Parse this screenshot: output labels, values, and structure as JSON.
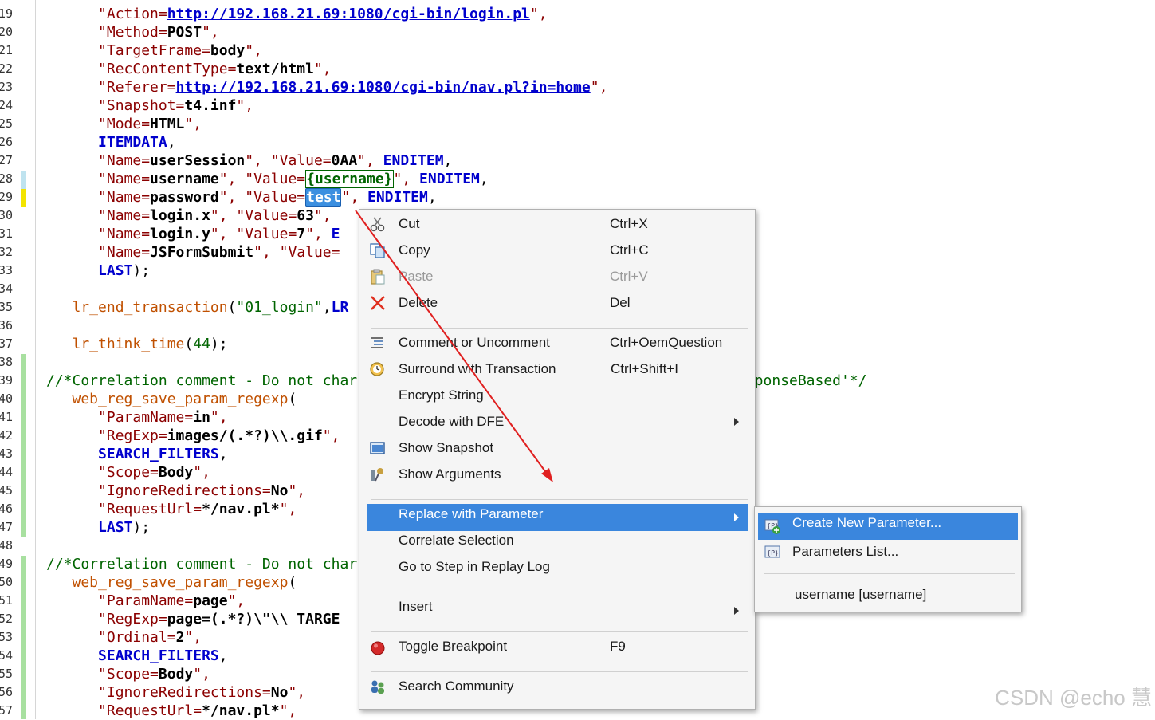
{
  "editor": {
    "line_numbers": [
      "19",
      "20",
      "21",
      "22",
      "23",
      "24",
      "25",
      "26",
      "27",
      "28",
      "29",
      "30",
      "31",
      "32",
      "33",
      "34",
      "35",
      "36",
      "37",
      "38",
      "39",
      "40",
      "41",
      "42",
      "43",
      "44",
      "45",
      "46",
      "47",
      "48",
      "49",
      "50",
      "51",
      "52",
      "53",
      "54",
      "55",
      "56",
      "57"
    ],
    "lines": [
      [
        {
          "c": "s",
          "t": "      \""
        },
        {
          "c": "s",
          "t": "Action="
        },
        {
          "c": "u",
          "t": "http://192.168.21.69:1080/cgi-bin/login.pl"
        },
        {
          "c": "s",
          "t": "\","
        }
      ],
      [
        {
          "c": "s",
          "t": "      \"Method="
        },
        {
          "c": "b",
          "t": "POST"
        },
        {
          "c": "s",
          "t": "\","
        }
      ],
      [
        {
          "c": "s",
          "t": "      \"TargetFrame="
        },
        {
          "c": "b",
          "t": "body"
        },
        {
          "c": "s",
          "t": "\","
        }
      ],
      [
        {
          "c": "s",
          "t": "      \"RecContentType="
        },
        {
          "c": "b",
          "t": "text/html"
        },
        {
          "c": "s",
          "t": "\","
        }
      ],
      [
        {
          "c": "s",
          "t": "      \"Referer="
        },
        {
          "c": "u",
          "t": "http://192.168.21.69:1080/cgi-bin/nav.pl?in=home"
        },
        {
          "c": "s",
          "t": "\","
        }
      ],
      [
        {
          "c": "s",
          "t": "      \"Snapshot="
        },
        {
          "c": "b",
          "t": "t4.inf"
        },
        {
          "c": "s",
          "t": "\","
        }
      ],
      [
        {
          "c": "s",
          "t": "      \"Mode="
        },
        {
          "c": "b",
          "t": "HTML"
        },
        {
          "c": "s",
          "t": "\","
        }
      ],
      [
        {
          "c": "k",
          "t": "      ITEMDATA"
        },
        {
          "c": "",
          "t": ","
        }
      ],
      [
        {
          "c": "s",
          "t": "      \"Name="
        },
        {
          "c": "b",
          "t": "userSession"
        },
        {
          "c": "s",
          "t": "\", \"Value="
        },
        {
          "c": "b",
          "t": "0AA"
        },
        {
          "c": "s",
          "t": "\", "
        },
        {
          "c": "k",
          "t": "ENDITEM"
        },
        {
          "c": "",
          "t": ","
        }
      ],
      [
        {
          "c": "s",
          "t": "      \"Name="
        },
        {
          "c": "b",
          "t": "username"
        },
        {
          "c": "s",
          "t": "\", \"Value="
        },
        {
          "c": "bx",
          "t": "{username}"
        },
        {
          "c": "s",
          "t": "\", "
        },
        {
          "c": "k",
          "t": "ENDITEM"
        },
        {
          "c": "",
          "t": ","
        }
      ],
      [
        {
          "c": "s",
          "t": "      \"Name="
        },
        {
          "c": "b",
          "t": "password"
        },
        {
          "c": "s",
          "t": "\", \"Value="
        },
        {
          "c": "sel",
          "t": "test"
        },
        {
          "c": "s",
          "t": "\", "
        },
        {
          "c": "k",
          "t": "ENDITEM"
        },
        {
          "c": "",
          "t": ","
        }
      ],
      [
        {
          "c": "s",
          "t": "      \"Name="
        },
        {
          "c": "b",
          "t": "login.x"
        },
        {
          "c": "s",
          "t": "\", \"Value="
        },
        {
          "c": "b",
          "t": "63"
        },
        {
          "c": "s",
          "t": "\","
        }
      ],
      [
        {
          "c": "s",
          "t": "      \"Name="
        },
        {
          "c": "b",
          "t": "login.y"
        },
        {
          "c": "s",
          "t": "\", \"Value="
        },
        {
          "c": "b",
          "t": "7"
        },
        {
          "c": "s",
          "t": "\", "
        },
        {
          "c": "k",
          "t": "E"
        }
      ],
      [
        {
          "c": "s",
          "t": "      \"Name="
        },
        {
          "c": "b",
          "t": "JSFormSubmit"
        },
        {
          "c": "s",
          "t": "\", \"Value="
        }
      ],
      [
        {
          "c": "k",
          "t": "      LAST"
        },
        {
          "c": "",
          "t": ");"
        }
      ],
      [
        {
          "c": "",
          "t": ""
        }
      ],
      [
        {
          "c": "f",
          "t": "   lr_end_transaction"
        },
        {
          "c": "",
          "t": "("
        },
        {
          "c": "n",
          "t": "\"01_login\""
        },
        {
          "c": "",
          "t": ","
        },
        {
          "c": "k",
          "t": "LR"
        }
      ],
      [
        {
          "c": "",
          "t": ""
        }
      ],
      [
        {
          "c": "f",
          "t": "   lr_think_time"
        },
        {
          "c": "",
          "t": "("
        },
        {
          "c": "n",
          "t": "44"
        },
        {
          "c": "",
          "t": ");"
        }
      ],
      [
        {
          "c": "",
          "t": ""
        }
      ],
      [
        {
          "c": "c",
          "t": "//*Correlation comment - Do not char"
        },
        {
          "c": "c",
          "t": "                                         ='ResponseBased'*/"
        }
      ],
      [
        {
          "c": "f",
          "t": "   web_reg_save_param_regexp"
        },
        {
          "c": "",
          "t": "("
        }
      ],
      [
        {
          "c": "s",
          "t": "      \"ParamName="
        },
        {
          "c": "b",
          "t": "in"
        },
        {
          "c": "s",
          "t": "\","
        }
      ],
      [
        {
          "c": "s",
          "t": "      \"RegExp="
        },
        {
          "c": "b",
          "t": "images/(.*?)\\\\.gif"
        },
        {
          "c": "s",
          "t": "\","
        }
      ],
      [
        {
          "c": "k",
          "t": "      SEARCH_FILTERS"
        },
        {
          "c": "",
          "t": ","
        }
      ],
      [
        {
          "c": "s",
          "t": "      \"Scope="
        },
        {
          "c": "b",
          "t": "Body"
        },
        {
          "c": "s",
          "t": "\","
        }
      ],
      [
        {
          "c": "s",
          "t": "      \"IgnoreRedirections="
        },
        {
          "c": "b",
          "t": "No"
        },
        {
          "c": "s",
          "t": "\","
        }
      ],
      [
        {
          "c": "s",
          "t": "      \"RequestUrl="
        },
        {
          "c": "b",
          "t": "*/nav.pl*"
        },
        {
          "c": "s",
          "t": "\","
        }
      ],
      [
        {
          "c": "k",
          "t": "      LAST"
        },
        {
          "c": "",
          "t": ");"
        }
      ],
      [
        {
          "c": "",
          "t": ""
        }
      ],
      [
        {
          "c": "c",
          "t": "//*Correlation comment - Do not char"
        }
      ],
      [
        {
          "c": "f",
          "t": "   web_reg_save_param_regexp"
        },
        {
          "c": "",
          "t": "("
        }
      ],
      [
        {
          "c": "s",
          "t": "      \"ParamName="
        },
        {
          "c": "b",
          "t": "page"
        },
        {
          "c": "s",
          "t": "\","
        }
      ],
      [
        {
          "c": "s",
          "t": "      \"RegExp="
        },
        {
          "c": "b",
          "t": "page=(.*?)\\\"\\\\ TARGE"
        }
      ],
      [
        {
          "c": "s",
          "t": "      \"Ordinal="
        },
        {
          "c": "b",
          "t": "2"
        },
        {
          "c": "s",
          "t": "\","
        }
      ],
      [
        {
          "c": "k",
          "t": "      SEARCH_FILTERS"
        },
        {
          "c": "",
          "t": ","
        }
      ],
      [
        {
          "c": "s",
          "t": "      \"Scope="
        },
        {
          "c": "b",
          "t": "Body"
        },
        {
          "c": "s",
          "t": "\","
        }
      ],
      [
        {
          "c": "s",
          "t": "      \"IgnoreRedirections="
        },
        {
          "c": "b",
          "t": "No"
        },
        {
          "c": "s",
          "t": "\","
        }
      ],
      [
        {
          "c": "s",
          "t": "      \"RequestUrl="
        },
        {
          "c": "b",
          "t": "*/nav.pl*"
        },
        {
          "c": "s",
          "t": "\","
        }
      ]
    ]
  },
  "context_menu": {
    "cut": {
      "label": "Cut",
      "shortcut": "Ctrl+X"
    },
    "copy": {
      "label": "Copy",
      "shortcut": "Ctrl+C"
    },
    "paste": {
      "label": "Paste",
      "shortcut": "Ctrl+V"
    },
    "delete": {
      "label": "Delete",
      "shortcut": "Del"
    },
    "comment": {
      "label": "Comment or Uncomment",
      "shortcut": "Ctrl+OemQuestion"
    },
    "surround": {
      "label": "Surround with Transaction",
      "shortcut": "Ctrl+Shift+I"
    },
    "encrypt": {
      "label": "Encrypt String"
    },
    "decode": {
      "label": "Decode with DFE"
    },
    "show_snapshot": {
      "label": "Show Snapshot"
    },
    "show_arguments": {
      "label": "Show Arguments"
    },
    "replace": {
      "label": "Replace with Parameter"
    },
    "correlate": {
      "label": "Correlate Selection"
    },
    "goto_step": {
      "label": "Go to Step in Replay Log"
    },
    "insert": {
      "label": "Insert"
    },
    "breakpoint": {
      "label": "Toggle Breakpoint",
      "shortcut": "F9"
    },
    "search": {
      "label": "Search Community"
    }
  },
  "submenu": {
    "create": {
      "label": "Create New Parameter..."
    },
    "list": {
      "label": "Parameters List..."
    },
    "existing": {
      "label": "username [username]"
    }
  },
  "watermark": "CSDN @echo 慧",
  "colors": {
    "accent": "#3a86dd",
    "arrow": "#e02020"
  }
}
